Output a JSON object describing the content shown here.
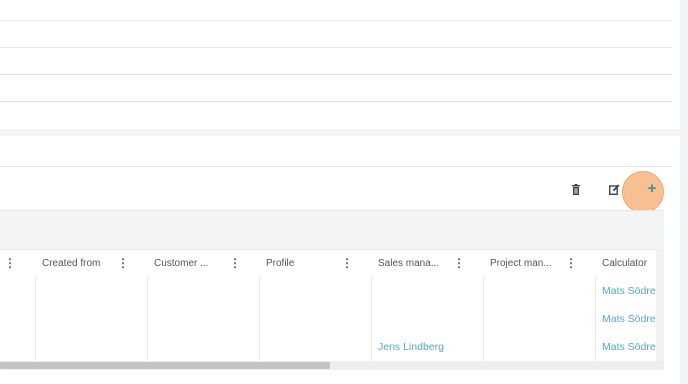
{
  "toolbar": {
    "delete_icon": "trash-icon",
    "edit_icon": "edit-icon",
    "add_icon": "plus-icon",
    "add_label": "+"
  },
  "columns": [
    {
      "label": "Created from"
    },
    {
      "label": "Customer ..."
    },
    {
      "label": "Profile"
    },
    {
      "label": "Sales mana..."
    },
    {
      "label": "Project man..."
    },
    {
      "label": "Calculator"
    }
  ],
  "rows": [
    {
      "sales_manager": "",
      "calculator": "Mats Södre"
    },
    {
      "sales_manager": "",
      "calculator": "Mats Södre"
    },
    {
      "sales_manager": "Jens Lindberg",
      "calculator": "Mats Södre"
    }
  ],
  "colors": {
    "link": "#5aa6c6",
    "highlight": "#f6bd8e",
    "accent": "#3a8f9a"
  }
}
